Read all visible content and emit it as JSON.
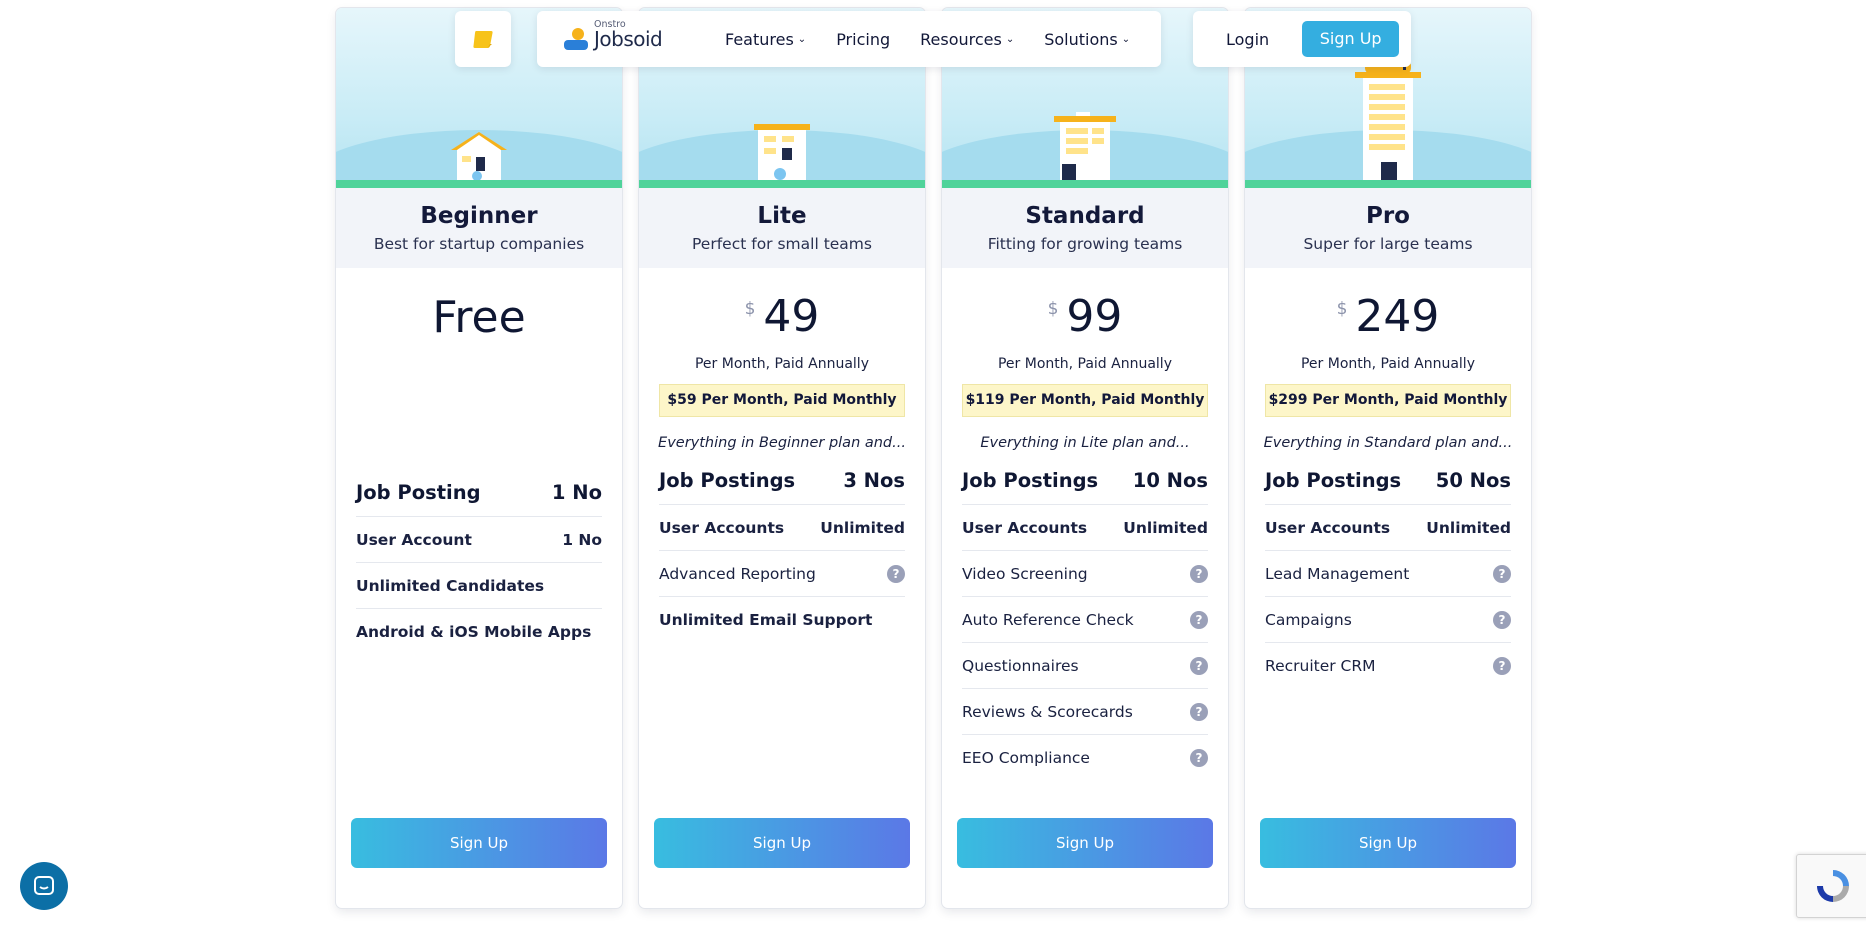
{
  "nav": {
    "brand_small": "Onstro",
    "brand_name": "Jobsoid",
    "menu": [
      {
        "label": "Features",
        "dropdown": true
      },
      {
        "label": "Pricing",
        "dropdown": false
      },
      {
        "label": "Resources",
        "dropdown": true
      },
      {
        "label": "Solutions",
        "dropdown": true
      }
    ],
    "login_label": "Login",
    "signup_label": "Sign Up"
  },
  "plans": [
    {
      "name": "Beginner",
      "subtitle": "Best for startup companies",
      "price_free": "Free",
      "main_feature": {
        "label": "Job Posting",
        "value": "1 No"
      },
      "features": [
        {
          "label": "User Account",
          "value": "1 No",
          "bold": true
        },
        {
          "label": "Unlimited Candidates",
          "bold": true
        },
        {
          "label": "Android & iOS Mobile Apps",
          "bold": true
        }
      ],
      "cta": "Sign Up"
    },
    {
      "name": "Lite",
      "subtitle": "Perfect for small teams",
      "currency": "$",
      "price": "49",
      "per": "Per Month, Paid Annually",
      "monthly": "$59 Per Month, Paid Monthly",
      "everything": "Everything in Beginner plan and...",
      "main_feature": {
        "label": "Job Postings",
        "value": "3 Nos"
      },
      "features": [
        {
          "label": "User Accounts",
          "value": "Unlimited",
          "bold": true
        },
        {
          "label": "Advanced Reporting",
          "help": true
        },
        {
          "label": "Unlimited Email Support",
          "bold": true
        }
      ],
      "cta": "Sign Up"
    },
    {
      "name": "Standard",
      "subtitle": "Fitting for growing teams",
      "currency": "$",
      "price": "99",
      "per": "Per Month, Paid Annually",
      "monthly": "$119 Per Month, Paid Monthly",
      "everything": "Everything in Lite plan and...",
      "main_feature": {
        "label": "Job Postings",
        "value": "10 Nos"
      },
      "features": [
        {
          "label": "User Accounts",
          "value": "Unlimited",
          "bold": true
        },
        {
          "label": "Video Screening",
          "help": true
        },
        {
          "label": "Auto Reference Check",
          "help": true
        },
        {
          "label": "Questionnaires",
          "help": true
        },
        {
          "label": "Reviews & Scorecards",
          "help": true
        },
        {
          "label": "EEO Compliance",
          "help": true
        }
      ],
      "cta": "Sign Up"
    },
    {
      "name": "Pro",
      "subtitle": "Super for large teams",
      "currency": "$",
      "price": "249",
      "per": "Per Month, Paid Annually",
      "monthly": "$299 Per Month, Paid Monthly",
      "everything": "Everything in Standard plan and...",
      "main_feature": {
        "label": "Job Postings",
        "value": "50 Nos"
      },
      "features": [
        {
          "label": "User Accounts",
          "value": "Unlimited",
          "bold": true
        },
        {
          "label": "Lead Management",
          "help": true
        },
        {
          "label": "Campaigns",
          "help": true
        },
        {
          "label": "Recruiter CRM",
          "help": true
        }
      ],
      "cta": "Sign Up"
    }
  ],
  "help_glyph": "?",
  "colors": {
    "accent_start": "#38bde0",
    "accent_end": "#5b78e6",
    "signup_top": "#34aee0",
    "monthly_bg": "#fdf6c9",
    "grass": "#4fd39a"
  },
  "icons": {
    "chat": "chat-bubble-icon",
    "recaptcha": "recaptcha-icon",
    "menu_dropdown": "chevron-down-icon",
    "help": "question-circle-icon"
  }
}
